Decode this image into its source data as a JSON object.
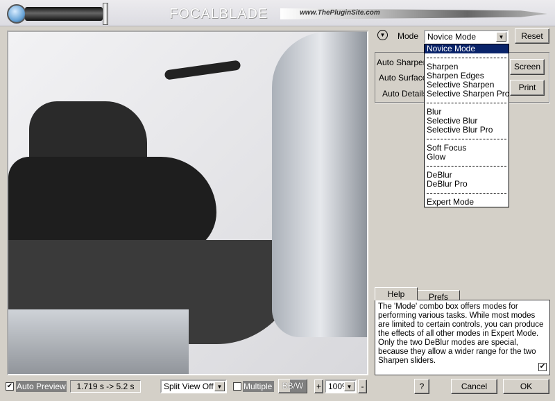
{
  "header": {
    "brand": "FOCALBLADE",
    "url": "www.ThePluginSite.com"
  },
  "mode": {
    "label": "Mode",
    "value": "Novice Mode",
    "reset": "Reset",
    "options": [
      {
        "label": "Novice Mode",
        "selected": true
      },
      {
        "sep": true
      },
      {
        "label": "Sharpen"
      },
      {
        "label": "Sharpen Edges"
      },
      {
        "label": "Selective Sharpen"
      },
      {
        "label": "Selective Sharpen Pro"
      },
      {
        "sep": true
      },
      {
        "label": "Blur"
      },
      {
        "label": "Selective Blur"
      },
      {
        "label": "Selective Blur Pro"
      },
      {
        "sep": true
      },
      {
        "label": "Soft Focus"
      },
      {
        "label": "Glow"
      },
      {
        "sep": true
      },
      {
        "label": "DeBlur"
      },
      {
        "label": "DeBlur Pro"
      },
      {
        "sep": true
      },
      {
        "label": "Expert Mode"
      }
    ]
  },
  "panel": {
    "auto_sharpen": "Auto Sharpen",
    "auto_surface": "Auto Surface",
    "auto_details": "Auto Details",
    "screen": "Screen",
    "print": "Print"
  },
  "tabs": {
    "help": "Help",
    "prefs": "Prefs"
  },
  "help_text": "The 'Mode' combo box offers modes for performing various tasks. While most modes are limited to certain controls, you can produce the effects of all other modes in Expert Mode. Only the two DeBlur modes are special, because they allow a wider range for the two Sharpen sliders.",
  "help_checked": true,
  "bottom": {
    "auto_preview": "Auto Preview",
    "auto_preview_checked": true,
    "timing": "1.719 s -> 5.2 s",
    "split_view": "Split View Off",
    "multiple": "Multiple",
    "multiple_checked": false,
    "bw": "BB/W",
    "plus": "+",
    "zoom": "100%",
    "minus": "-",
    "help": "?",
    "cancel": "Cancel",
    "ok": "OK"
  },
  "colors": {
    "selection": "#0a246a",
    "face": "#d4d0c8"
  }
}
